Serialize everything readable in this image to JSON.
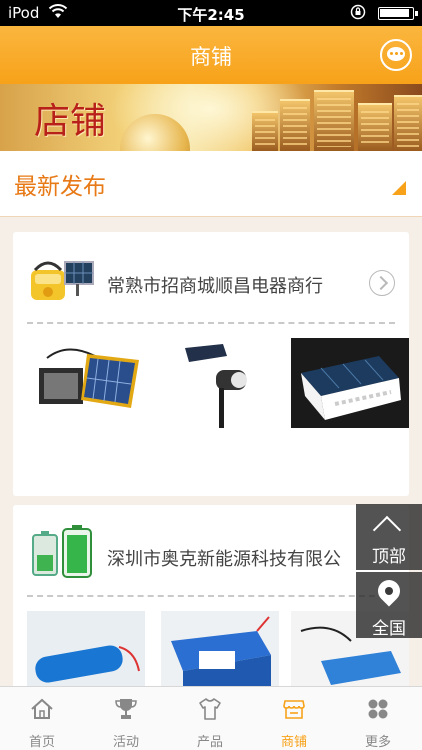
{
  "status_bar": {
    "carrier": "iPod",
    "time": "下午2:45"
  },
  "nav": {
    "title": "商铺"
  },
  "banner": {
    "title": "店铺"
  },
  "section": {
    "title": "最新发布"
  },
  "shops": [
    {
      "name": "常熟市招商城顺昌电器商行"
    },
    {
      "name": "深圳市奥克新能源科技有限公"
    }
  ],
  "floating": {
    "top_label": "顶部",
    "all_label": "全国"
  },
  "tabs": [
    {
      "label": "首页",
      "icon": "home-icon"
    },
    {
      "label": "活动",
      "icon": "trophy-icon"
    },
    {
      "label": "产品",
      "icon": "shirt-icon"
    },
    {
      "label": "商铺",
      "icon": "shop-icon"
    },
    {
      "label": "更多",
      "icon": "more-icon"
    }
  ],
  "colors": {
    "accent": "#f7a219",
    "section_title": "#e77a16",
    "background": "#f5efe8"
  }
}
